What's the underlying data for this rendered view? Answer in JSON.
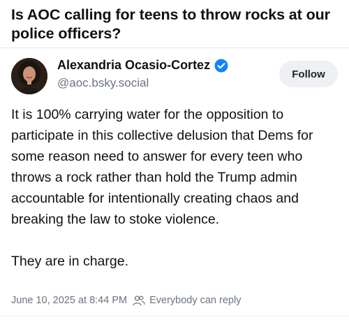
{
  "headline": "Is AOC calling for teens to throw rocks at our police officers?",
  "post": {
    "author": {
      "display_name": "Alexandria Ocasio-Cortez",
      "handle": "@aoc.bsky.social",
      "verified_icon": "verified-badge-icon",
      "avatar_icon": "avatar"
    },
    "follow_label": "Follow",
    "body": [
      "It is 100% carrying water for the opposition to participate in this collective delusion that Dems for some reason need to answer for every teen who throws a rock rather than hold the Trump admin accountable for intentionally creating chaos and breaking the law to stoke violence.",
      "They are in charge."
    ],
    "timestamp": "June 10, 2025 at 8:44 PM",
    "reply_setting": "Everybody can reply",
    "reply_icon": "people-icon"
  },
  "colors": {
    "accent": "#1083fe",
    "muted_text": "#6b7480",
    "follow_bg": "#eef0f4"
  }
}
